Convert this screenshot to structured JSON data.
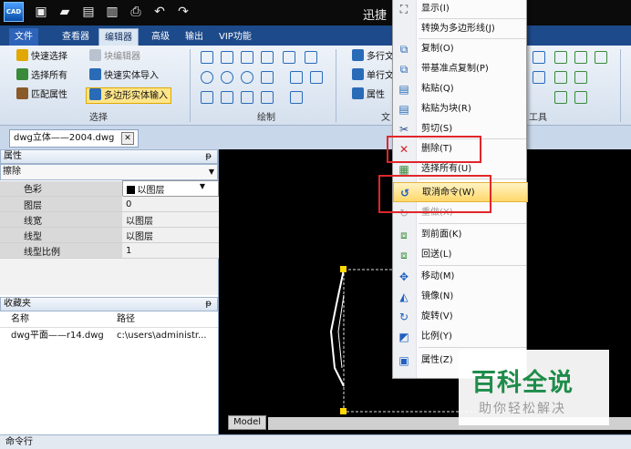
{
  "app": {
    "logo": "CAD",
    "title": "迅捷"
  },
  "quick_access": [
    "new-icon",
    "open-icon",
    "save-icon",
    "save-as-icon",
    "print-icon",
    "undo-icon",
    "redo-icon"
  ],
  "ribbon_tabs": [
    "文件",
    "查看器",
    "编辑器",
    "高级",
    "输出",
    "VIP功能"
  ],
  "active_tab": "编辑器",
  "ribbon": {
    "select_group": {
      "label": "选择",
      "items": [
        "快速选择",
        "块编辑器",
        "选择所有",
        "快速实体导入",
        "匹配属性",
        "多边形实体输入"
      ]
    },
    "draw_group": {
      "label": "绘制"
    },
    "text_group": {
      "label": "文",
      "items": [
        "多行文",
        "单行文",
        "属性"
      ]
    },
    "tools_group": {
      "label": "工具"
    }
  },
  "doc_tab": {
    "name": "dwg立体——2004.dwg",
    "close": "✕"
  },
  "properties": {
    "title": "属性",
    "selector": "擦除",
    "rows": [
      {
        "name": "色彩",
        "value": "以图层"
      },
      {
        "name": "图层",
        "value": "0"
      },
      {
        "name": "线宽",
        "value": "以图层"
      },
      {
        "name": "线型",
        "value": "以图层"
      },
      {
        "name": "线型比例",
        "value": "1"
      }
    ]
  },
  "favorites": {
    "title": "收藏夹",
    "columns": [
      "名称",
      "路径"
    ],
    "rows": [
      {
        "name": "dwg平面——r14.dwg",
        "path": "c:\\users\\administr..."
      }
    ]
  },
  "model_tab": "Model",
  "command_line": "命令行",
  "context_menu": {
    "items": [
      {
        "label": "显示(I)",
        "icon": "display-icon",
        "disabled": false
      },
      {
        "label": "转换为多边形线(J)",
        "icon": "",
        "disabled": false
      },
      {
        "label": "复制(O)",
        "icon": "copy-icon",
        "disabled": false
      },
      {
        "label": "带基准点复制(P)",
        "icon": "copy-base-icon",
        "disabled": false
      },
      {
        "label": "粘贴(Q)",
        "icon": "paste-icon",
        "disabled": false
      },
      {
        "label": "粘贴为块(R)",
        "icon": "paste-block-icon",
        "disabled": false
      },
      {
        "label": "剪切(S)",
        "icon": "scissors-icon",
        "disabled": false
      },
      {
        "label": "删除(T)",
        "icon": "delete-icon",
        "disabled": false
      },
      {
        "label": "选择所有(U)",
        "icon": "select-all-icon",
        "disabled": false
      },
      {
        "label": "取消命令(W)",
        "icon": "undo-command-icon",
        "disabled": false
      },
      {
        "label": "重做(X)",
        "icon": "redo-icon",
        "disabled": true
      },
      {
        "label": "到前面(K)",
        "icon": "bring-front-icon",
        "disabled": false
      },
      {
        "label": "回送(L)",
        "icon": "send-back-icon",
        "disabled": false
      },
      {
        "label": "移动(M)",
        "icon": "move-icon",
        "disabled": false
      },
      {
        "label": "镜像(N)",
        "icon": "mirror-icon",
        "disabled": false
      },
      {
        "label": "旋转(V)",
        "icon": "rotate-icon",
        "disabled": false
      },
      {
        "label": "比例(Y)",
        "icon": "scale-icon",
        "disabled": false
      },
      {
        "label": "属性(Z)",
        "icon": "properties-icon",
        "disabled": false
      }
    ],
    "highlighted": "取消命令(W)",
    "annotated": [
      "删除(T)",
      "取消命令(W)"
    ]
  },
  "watermark": {
    "title": "百科全说",
    "subtitle": "助你轻松解决"
  },
  "colors": {
    "accent_red": "#e0262b",
    "ribbon_blue": "#1d4a8a",
    "watermark_green": "#1e8c4a"
  }
}
